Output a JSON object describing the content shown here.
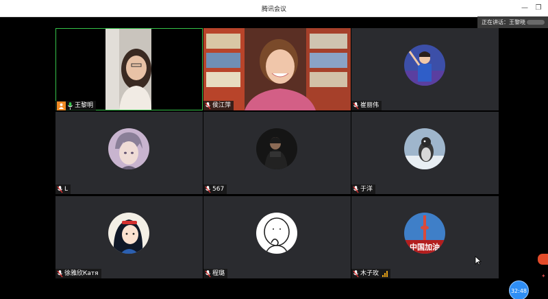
{
  "window": {
    "title": "腾讯会议",
    "minimize_icon": "minimize-icon",
    "restore_icon": "restore-icon"
  },
  "speaking": {
    "label": "正在讲话：",
    "name": "王黎晓"
  },
  "participants": [
    {
      "name": "王黎明",
      "is_host": true,
      "video": true,
      "mic": "unmuted"
    },
    {
      "name": "侯江萍",
      "video": true,
      "mic": "muted"
    },
    {
      "name": "崔丽伟",
      "video": false,
      "mic": "muted"
    },
    {
      "name": "L",
      "video": false,
      "mic": "muted"
    },
    {
      "name": "567",
      "video": false,
      "mic": "muted"
    },
    {
      "name": "于洋",
      "video": false,
      "mic": "muted"
    },
    {
      "name": "徐雅欣Катя",
      "video": false,
      "mic": "muted"
    },
    {
      "name": "程璐",
      "video": false,
      "mic": "muted"
    },
    {
      "name": "木子玫",
      "video": false,
      "mic": "muted",
      "signal_icon": "signal-bars-icon"
    }
  ],
  "avatar_texts": {
    "china_flag_text": "中国加油"
  },
  "timer": {
    "text": "32:48"
  },
  "colors": {
    "active_border": "#35c44a",
    "host_badge": "#f08a24",
    "timer": "#2f8ef5",
    "tile_bg": "#2a2b2f"
  }
}
